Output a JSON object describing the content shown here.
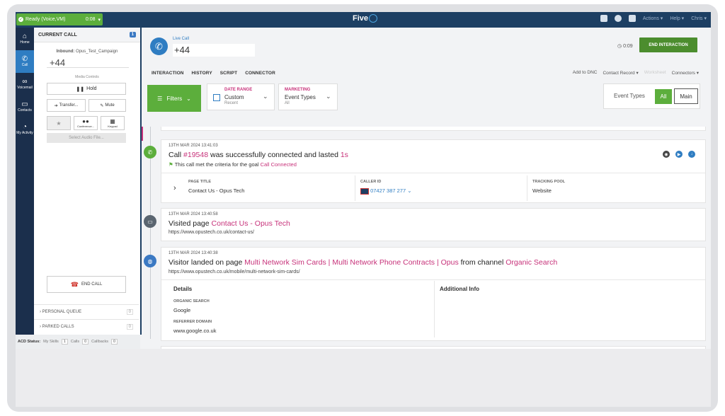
{
  "topbar": {
    "status": "Ready",
    "status_mode": "(Voice,VM)",
    "status_time": "0:08",
    "logo_text": "Five",
    "menu": [
      "Actions",
      "Help",
      "Chris"
    ]
  },
  "leftnav": {
    "items": [
      {
        "label": "Home",
        "icon": "home-icon"
      },
      {
        "label": "Call",
        "icon": "phone-icon",
        "active": true
      },
      {
        "label": "Voicemail",
        "icon": "voicemail-icon"
      },
      {
        "label": "Contacts",
        "icon": "folder-icon"
      },
      {
        "label": "My Activity",
        "icon": "activity-icon"
      }
    ]
  },
  "callpanel": {
    "title": "CURRENT CALL",
    "badge": "1",
    "inbound_label": "Inbound:",
    "inbound_campaign": "Opus_Test_Campaign",
    "number": "+44",
    "media_controls_label": "Media Controls",
    "hold": "Hold",
    "transfer": "Transfer...",
    "mute": "Mute",
    "conference": "Conference...",
    "keypad": "Keypad",
    "select_audio": "Select Audio File...",
    "end_call": "END CALL",
    "personal_queue": "PERSONAL QUEUE",
    "personal_queue_count": "0",
    "parked_calls": "PARKED CALLS",
    "parked_calls_count": "0"
  },
  "acd": {
    "label": "ACD Status:",
    "skills_label": "My Skills",
    "skills": "1",
    "calls_label": "Calls",
    "calls": "0",
    "callbacks_label": "Callbacks",
    "callbacks": "0"
  },
  "main": {
    "live_label": "Live Call",
    "live_number": "+44",
    "timer": "0:09",
    "end_interaction": "END INTERACTION",
    "tabs": [
      "INTERACTION",
      "HISTORY",
      "SCRIPT",
      "CONNECTOR"
    ],
    "add_dnc": "Add to DNC",
    "contact_record": "Contact Record",
    "worksheet": "Worksheet",
    "connectors": "Connectors"
  },
  "filters": {
    "button": "Filters",
    "date_range_title": "DATE RANGE",
    "date_range_value": "Custom",
    "date_range_sub": "Recent",
    "marketing_title": "MARKETING",
    "marketing_value": "Event Types",
    "marketing_sub": "All",
    "event_types_label": "Event Types",
    "all": "All",
    "main": "Main"
  },
  "events": {
    "call": {
      "timestamp": "13TH MAR 2024 13:41:03",
      "prefix": "Call ",
      "call_id": "#19548",
      "middle": " was successfully connected and lasted ",
      "duration": "1s",
      "goal_text": "This call met the criteria for the goal ",
      "goal_name": "Call Connected",
      "page_title_label": "PAGE TITLE",
      "page_title": "Contact Us - Opus Tech",
      "caller_id_label": "CALLER ID",
      "caller_id": "07427 387 277",
      "tracking_pool_label": "TRACKING POOL",
      "tracking_pool": "Website"
    },
    "visit": {
      "timestamp": "13TH MAR 2024 13:40:58",
      "prefix": "Visited page ",
      "page": "Contact Us - Opus Tech",
      "url": "https://www.opustech.co.uk/contact-us/"
    },
    "landing": {
      "timestamp": "13TH MAR 2024 13:40:38",
      "prefix": "Visitor landed on page ",
      "page": "Multi Network Sim Cards | Multi Network Phone Contracts | Opus",
      "middle": " from channel ",
      "channel": "Organic Search",
      "url": "https://www.opustech.co.uk/mobile/multi-network-sim-cards/",
      "details_label": "Details",
      "additional_label": "Additional Info",
      "organic_label": "ORGANIC SEARCH",
      "organic_value": "Google",
      "referrer_label": "REFERRER DOMAIN",
      "referrer_value": "www.google.co.uk"
    }
  },
  "colors": {
    "accent_green": "#5cae3c",
    "brand_navy": "#1d3f63",
    "accent_blue": "#2f7dc2",
    "highlight_pink": "#c7327a"
  }
}
